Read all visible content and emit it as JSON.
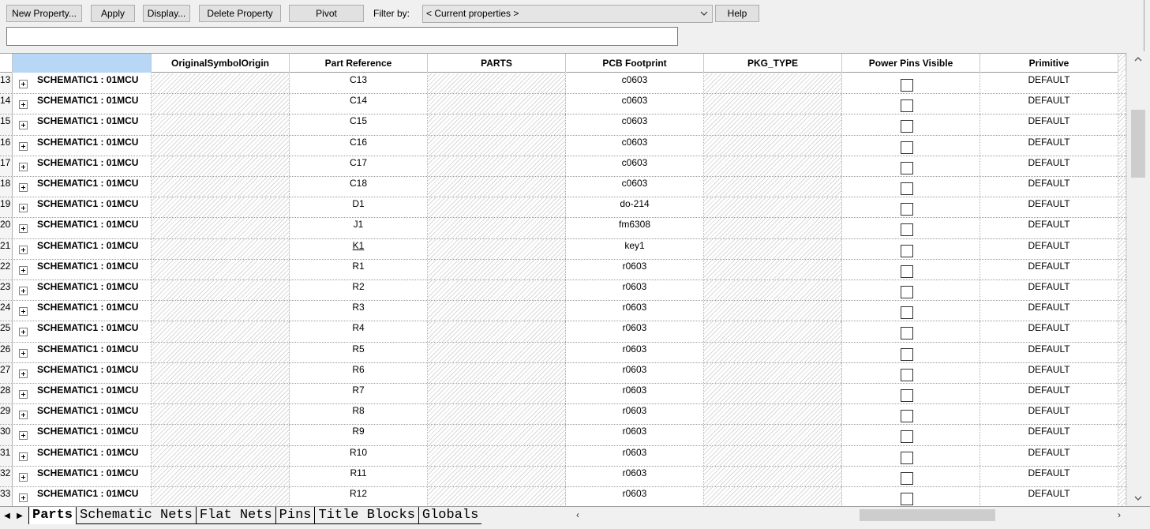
{
  "toolbar": {
    "new_property": "New Property...",
    "apply": "Apply",
    "display": "Display...",
    "delete_property": "Delete Property",
    "pivot": "Pivot",
    "filter_label": "Filter by:",
    "filter_value": "< Current properties >",
    "help": "Help",
    "edit_value": ""
  },
  "columns": [
    "",
    "OriginalSymbolOrigin",
    "Part Reference",
    "PARTS",
    "PCB Footprint",
    "PKG_TYPE",
    "Power Pins Visible",
    "Primitive"
  ],
  "rows": [
    {
      "num": "13",
      "name": "SCHEMATIC1 : 01MCU",
      "ref": "C13",
      "footprint": "c0603",
      "primitive": "DEFAULT"
    },
    {
      "num": "14",
      "name": "SCHEMATIC1 : 01MCU",
      "ref": "C14",
      "footprint": "c0603",
      "primitive": "DEFAULT"
    },
    {
      "num": "15",
      "name": "SCHEMATIC1 : 01MCU",
      "ref": "C15",
      "footprint": "c0603",
      "primitive": "DEFAULT"
    },
    {
      "num": "16",
      "name": "SCHEMATIC1 : 01MCU",
      "ref": "C16",
      "footprint": "c0603",
      "primitive": "DEFAULT"
    },
    {
      "num": "17",
      "name": "SCHEMATIC1 : 01MCU",
      "ref": "C17",
      "footprint": "c0603",
      "primitive": "DEFAULT"
    },
    {
      "num": "18",
      "name": "SCHEMATIC1 : 01MCU",
      "ref": "C18",
      "footprint": "c0603",
      "primitive": "DEFAULT"
    },
    {
      "num": "19",
      "name": "SCHEMATIC1 : 01MCU",
      "ref": "D1",
      "footprint": "do-214",
      "primitive": "DEFAULT"
    },
    {
      "num": "20",
      "name": "SCHEMATIC1 : 01MCU",
      "ref": "J1",
      "footprint": "fm6308",
      "primitive": "DEFAULT"
    },
    {
      "num": "21",
      "name": "SCHEMATIC1 : 01MCU",
      "ref": "K1",
      "footprint": "key1",
      "primitive": "DEFAULT"
    },
    {
      "num": "22",
      "name": "SCHEMATIC1 : 01MCU",
      "ref": "R1",
      "footprint": "r0603",
      "primitive": "DEFAULT"
    },
    {
      "num": "23",
      "name": "SCHEMATIC1 : 01MCU",
      "ref": "R2",
      "footprint": "r0603",
      "primitive": "DEFAULT"
    },
    {
      "num": "24",
      "name": "SCHEMATIC1 : 01MCU",
      "ref": "R3",
      "footprint": "r0603",
      "primitive": "DEFAULT"
    },
    {
      "num": "25",
      "name": "SCHEMATIC1 : 01MCU",
      "ref": "R4",
      "footprint": "r0603",
      "primitive": "DEFAULT"
    },
    {
      "num": "26",
      "name": "SCHEMATIC1 : 01MCU",
      "ref": "R5",
      "footprint": "r0603",
      "primitive": "DEFAULT"
    },
    {
      "num": "27",
      "name": "SCHEMATIC1 : 01MCU",
      "ref": "R6",
      "footprint": "r0603",
      "primitive": "DEFAULT"
    },
    {
      "num": "28",
      "name": "SCHEMATIC1 : 01MCU",
      "ref": "R7",
      "footprint": "r0603",
      "primitive": "DEFAULT"
    },
    {
      "num": "29",
      "name": "SCHEMATIC1 : 01MCU",
      "ref": "R8",
      "footprint": "r0603",
      "primitive": "DEFAULT"
    },
    {
      "num": "30",
      "name": "SCHEMATIC1 : 01MCU",
      "ref": "R9",
      "footprint": "r0603",
      "primitive": "DEFAULT"
    },
    {
      "num": "31",
      "name": "SCHEMATIC1 : 01MCU",
      "ref": "R10",
      "footprint": "r0603",
      "primitive": "DEFAULT"
    },
    {
      "num": "32",
      "name": "SCHEMATIC1 : 01MCU",
      "ref": "R11",
      "footprint": "r0603",
      "primitive": "DEFAULT"
    },
    {
      "num": "33",
      "name": "SCHEMATIC1 : 01MCU",
      "ref": "R12",
      "footprint": "r0603",
      "primitive": "DEFAULT"
    }
  ],
  "tabs": [
    "Parts",
    "Schematic Nets",
    "Flat Nets",
    "Pins",
    "Title Blocks",
    "Globals"
  ],
  "active_tab": "Parts",
  "icons": {
    "expand": "plus-box-icon",
    "checkbox": "checkbox-icon",
    "combo_arrow": "chevron-down-icon",
    "scroll_up": "chevron-up-icon",
    "scroll_down": "chevron-down-icon",
    "scroll_left": "chevron-left-icon",
    "scroll_right": "chevron-right-icon"
  },
  "colors": {
    "selected_header": "#b8d7f5",
    "hatch": "#d9d9d9"
  }
}
